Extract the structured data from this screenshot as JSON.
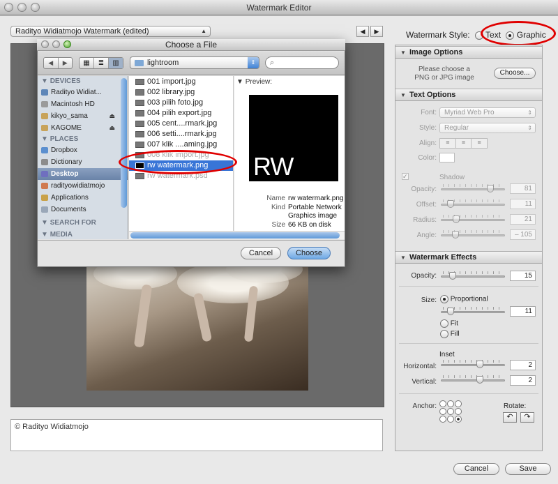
{
  "window": {
    "title": "Watermark Editor"
  },
  "preset": {
    "selected": "Radityo Widiatmojo Watermark (edited)"
  },
  "nav": {
    "prev_glyph": "◀",
    "next_glyph": "▶"
  },
  "copyright_text": "© Radityo Widiatmojo",
  "watermark_style": {
    "label": "Watermark Style:",
    "options": [
      "Text",
      "Graphic"
    ],
    "selected": "Graphic"
  },
  "image_options": {
    "title": "Image Options",
    "hint_line1": "Please choose a",
    "hint_line2": "PNG or JPG image",
    "choose_button": "Choose..."
  },
  "text_options": {
    "title": "Text Options",
    "font_label": "Font:",
    "font_value": "Myriad Web Pro",
    "style_label": "Style:",
    "style_value": "Regular",
    "align_label": "Align:",
    "color_label": "Color:",
    "shadow_label": "Shadow",
    "sliders": [
      {
        "label": "Opacity:",
        "value": "81",
        "level": 0.81
      },
      {
        "label": "Offset:",
        "value": "11",
        "level": 0.11
      },
      {
        "label": "Radius:",
        "value": "21",
        "level": 0.21
      },
      {
        "label": "Angle:",
        "value": "– 105",
        "level": 0.2
      }
    ]
  },
  "watermark_effects": {
    "title": "Watermark Effects",
    "opacity_label": "Opacity:",
    "opacity_value": "15",
    "opacity_level": 0.15,
    "size_label": "Size:",
    "size_options": [
      "Proportional",
      "Fit",
      "Fill"
    ],
    "size_selected": "Proportional",
    "size_value": "11",
    "size_level": 0.11,
    "inset_label": "Inset",
    "horizontal_label": "Horizontal:",
    "horizontal_value": "2",
    "vertical_label": "Vertical:",
    "vertical_value": "2",
    "anchor_label": "Anchor:",
    "rotate_label": "Rotate:",
    "rotate_left_glyph": "↶",
    "rotate_right_glyph": "↷"
  },
  "footer": {
    "cancel": "Cancel",
    "save": "Save"
  },
  "dialog": {
    "title": "Choose a File",
    "location": "lightroom",
    "search_glyph": "⌕",
    "sidebar": {
      "devices_header": "DEVICES",
      "devices": [
        {
          "label": "Radityo Widiat...",
          "eject": false
        },
        {
          "label": "Macintosh HD",
          "eject": false
        },
        {
          "label": "kikyo_sama",
          "eject": true
        },
        {
          "label": "KAGOME",
          "eject": true
        }
      ],
      "places_header": "PLACES",
      "places": [
        {
          "label": "Dropbox"
        },
        {
          "label": "Dictionary"
        },
        {
          "label": "Desktop"
        },
        {
          "label": "radityowidiatmojo"
        },
        {
          "label": "Applications"
        },
        {
          "label": "Documents"
        }
      ],
      "search_header": "SEARCH FOR",
      "media_header": "MEDIA",
      "selected": "Desktop"
    },
    "files": [
      "001 import.jpg",
      "002 library.jpg",
      "003 pilih foto.jpg",
      "004 pilih export.jpg",
      "005 cent....rmark.jpg",
      "006 setti....rmark.jpg",
      "007 klik ....aming.jpg",
      "008 klik import.jpg",
      "rw watermark.png",
      "rw watermark.psd"
    ],
    "selected_file": "rw watermark.png",
    "preview": {
      "header": "Preview:",
      "image_text": "RW",
      "name_key": "Name",
      "name_val": "rw watermark.png",
      "kind_key": "Kind",
      "kind_val1": "Portable Network",
      "kind_val2": "Graphics image",
      "size_key": "Size",
      "size_val": "66 KB on disk"
    },
    "cancel": "Cancel",
    "choose": "Choose"
  },
  "colors": {
    "annotation_ring": "#e00000",
    "selection_blue": "#3875d7",
    "default_button": "#6ea8e4"
  }
}
